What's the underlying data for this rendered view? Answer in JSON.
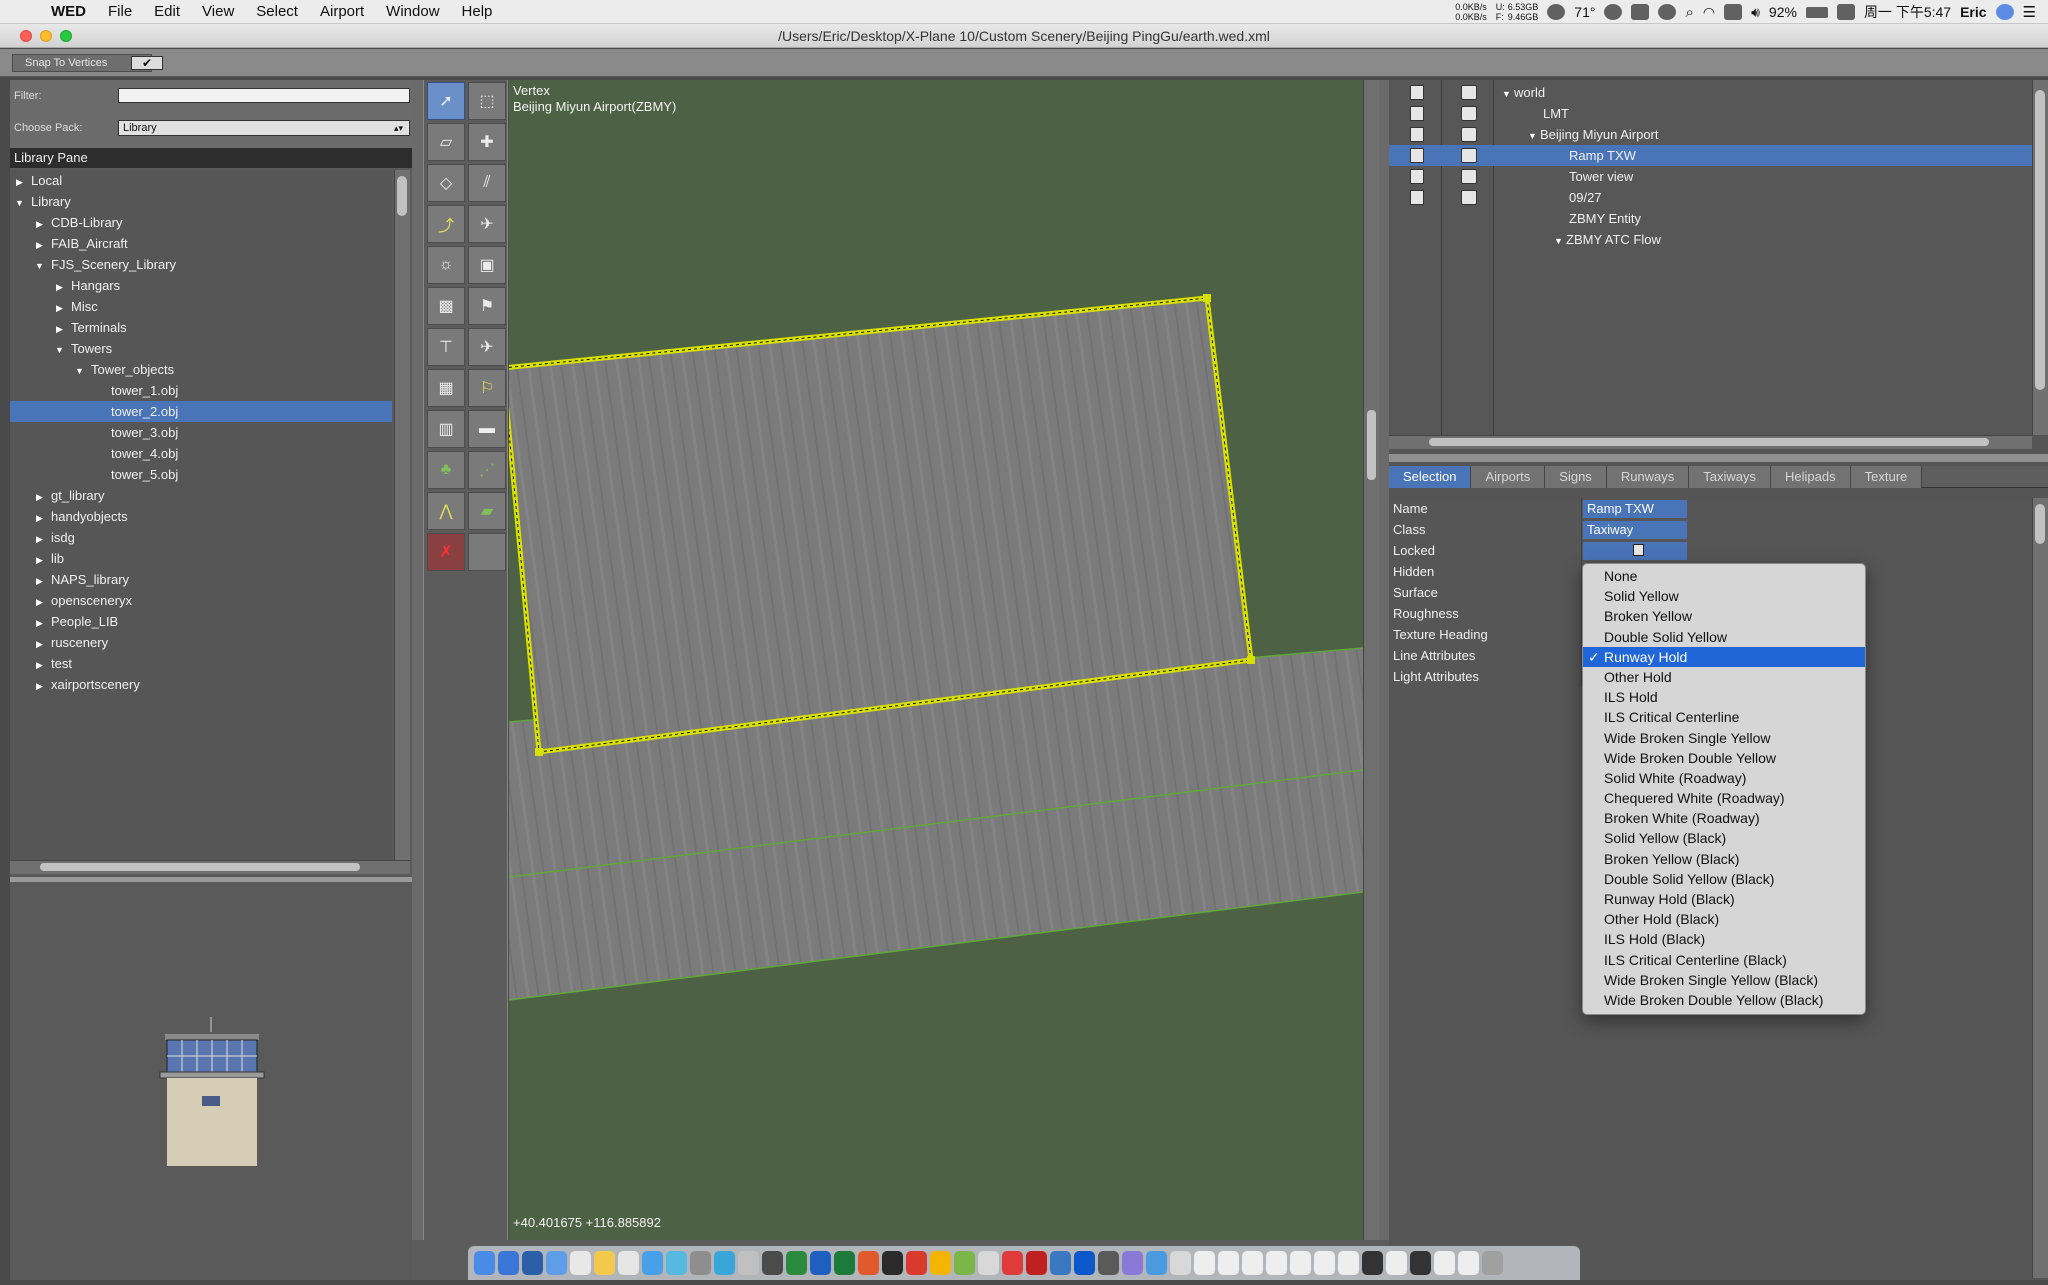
{
  "menubar": {
    "apple": "",
    "app": "WED",
    "items": [
      "File",
      "Edit",
      "View",
      "Select",
      "Airport",
      "Window",
      "Help"
    ],
    "net_up": "0.0KB/s",
    "net_down": "0.0KB/s",
    "mem_u_label": "U:",
    "mem_f_label": "F:",
    "mem_u": "6.53GB",
    "mem_f": "9.46GB",
    "temp": "71°",
    "battery": "92%",
    "datetime": "周一 下午5:47",
    "user": "Eric"
  },
  "window": {
    "title": "/Users/Eric/Desktop/X-Plane 10/Custom Scenery/Beijing PingGu/earth.wed.xml"
  },
  "toolbar": {
    "snap_label": "Snap To Vertices",
    "snap_check": "✔"
  },
  "library": {
    "filter_label": "Filter:",
    "filter_value": "",
    "choose_label": "Choose Pack:",
    "choose_value": "Library",
    "pane_title": "Library Pane",
    "tree": [
      {
        "label": "Local",
        "depth": 0,
        "arrow": "right",
        "selected": false
      },
      {
        "label": "Library",
        "depth": 0,
        "arrow": "down",
        "selected": false
      },
      {
        "label": "CDB-Library",
        "depth": 1,
        "arrow": "right",
        "selected": false
      },
      {
        "label": "FAIB_Aircraft",
        "depth": 1,
        "arrow": "right",
        "selected": false
      },
      {
        "label": "FJS_Scenery_Library",
        "depth": 1,
        "arrow": "down",
        "selected": false
      },
      {
        "label": "Hangars",
        "depth": 2,
        "arrow": "right",
        "selected": false
      },
      {
        "label": "Misc",
        "depth": 2,
        "arrow": "right",
        "selected": false
      },
      {
        "label": "Terminals",
        "depth": 2,
        "arrow": "right",
        "selected": false
      },
      {
        "label": "Towers",
        "depth": 2,
        "arrow": "down",
        "selected": false
      },
      {
        "label": "Tower_objects",
        "depth": 3,
        "arrow": "down",
        "selected": false
      },
      {
        "label": "tower_1.obj",
        "depth": 4,
        "arrow": "none",
        "selected": false
      },
      {
        "label": "tower_2.obj",
        "depth": 4,
        "arrow": "none",
        "selected": true
      },
      {
        "label": "tower_3.obj",
        "depth": 4,
        "arrow": "none",
        "selected": false
      },
      {
        "label": "tower_4.obj",
        "depth": 4,
        "arrow": "none",
        "selected": false
      },
      {
        "label": "tower_5.obj",
        "depth": 4,
        "arrow": "none",
        "selected": false
      },
      {
        "label": "gt_library",
        "depth": 1,
        "arrow": "right",
        "selected": false
      },
      {
        "label": "handyobjects",
        "depth": 1,
        "arrow": "right",
        "selected": false
      },
      {
        "label": "isdg",
        "depth": 1,
        "arrow": "right",
        "selected": false
      },
      {
        "label": "lib",
        "depth": 1,
        "arrow": "right",
        "selected": false
      },
      {
        "label": "NAPS_library",
        "depth": 1,
        "arrow": "right",
        "selected": false
      },
      {
        "label": "opensceneryx",
        "depth": 1,
        "arrow": "right",
        "selected": false
      },
      {
        "label": "People_LIB",
        "depth": 1,
        "arrow": "right",
        "selected": false
      },
      {
        "label": "ruscenery",
        "depth": 1,
        "arrow": "right",
        "selected": false
      },
      {
        "label": "test",
        "depth": 1,
        "arrow": "right",
        "selected": false
      },
      {
        "label": "xairportscenery",
        "depth": 1,
        "arrow": "right",
        "selected": false
      }
    ]
  },
  "tools": [
    {
      "icon": "vertex-tool-icon",
      "glyph": "➚",
      "active": true
    },
    {
      "icon": "marquee-tool-icon",
      "glyph": "⬚",
      "active": false
    },
    {
      "icon": "runway-tool-icon",
      "glyph": "▱",
      "active": false
    },
    {
      "icon": "helipad-tool-icon",
      "glyph": "✚",
      "active": false
    },
    {
      "icon": "taxiway-tool-icon",
      "glyph": "◇",
      "active": false
    },
    {
      "icon": "sealane-tool-icon",
      "glyph": "⫽",
      "active": false
    },
    {
      "icon": "taxiroute-tool-icon",
      "glyph": "⤴",
      "active": false
    },
    {
      "icon": "ramp-start-tool-icon",
      "glyph": "✈",
      "active": false
    },
    {
      "icon": "light-fixture-tool-icon",
      "glyph": "☼",
      "active": false
    },
    {
      "icon": "sign-tool-icon",
      "glyph": "▣",
      "active": false
    },
    {
      "icon": "object-tool-icon",
      "glyph": "▩",
      "active": false
    },
    {
      "icon": "windsock-tool-icon",
      "glyph": "⚑",
      "active": false
    },
    {
      "icon": "tower-viewpoint-tool-icon",
      "glyph": "⊤",
      "active": false
    },
    {
      "icon": "airplane-tool-icon",
      "glyph": "✈",
      "active": false
    },
    {
      "icon": "facade-tool-icon",
      "glyph": "▦",
      "active": false
    },
    {
      "icon": "atc-tool-icon",
      "glyph": "⚐",
      "active": false
    },
    {
      "icon": "building-tool-icon",
      "glyph": "▥",
      "active": false
    },
    {
      "icon": "truck-tool-icon",
      "glyph": "▬",
      "active": false
    },
    {
      "icon": "forest-tool-icon",
      "glyph": "♣",
      "active": false
    },
    {
      "icon": "string-tool-icon",
      "glyph": "⋰",
      "active": false
    },
    {
      "icon": "line-tool-icon",
      "glyph": "⋀",
      "active": false
    },
    {
      "icon": "polygon-tool-icon",
      "glyph": "▰",
      "active": false
    },
    {
      "icon": "exclusion-tool-icon",
      "glyph": "✗",
      "active": false
    },
    {
      "icon": "empty-tool-icon",
      "glyph": "",
      "active": false
    }
  ],
  "map": {
    "mode": "Vertex",
    "airport": "Beijing Miyun Airport(ZBMY)",
    "coords": "+40.401675 +116.885892",
    "colors": {
      "grass": "#4d6144",
      "pavement": "#7c7c7c",
      "selection": "#d8e000",
      "taxi_edge": "#5ea83a"
    }
  },
  "hierarchy": [
    {
      "label": "world",
      "indent": 0,
      "arrow": "down",
      "selected": false,
      "icons": true
    },
    {
      "label": "LMT",
      "indent": 1,
      "arrow": "none",
      "selected": false,
      "icons": true
    },
    {
      "label": "Beijing Miyun Airport",
      "indent": 1,
      "arrow": "down",
      "selected": false,
      "icons": true
    },
    {
      "label": "Ramp TXW",
      "indent": 2,
      "arrow": "none",
      "selected": true,
      "icons": true
    },
    {
      "label": "Tower view",
      "indent": 2,
      "arrow": "none",
      "selected": false,
      "icons": true
    },
    {
      "label": "09/27",
      "indent": 2,
      "arrow": "none",
      "selected": false,
      "icons": true
    },
    {
      "label": "ZBMY Entity",
      "indent": 2,
      "arrow": "none",
      "selected": false,
      "icons": false
    },
    {
      "label": "ZBMY ATC Flow",
      "indent": 2,
      "arrow": "down",
      "selected": false,
      "icons": false
    }
  ],
  "tabs": [
    "Selection",
    "Airports",
    "Signs",
    "Runways",
    "Taxiways",
    "Helipads",
    "Texture"
  ],
  "active_tab": "Selection",
  "properties": [
    {
      "name": "Name",
      "value": "Ramp TXW"
    },
    {
      "name": "Class",
      "value": "Taxiway"
    },
    {
      "name": "Locked",
      "value": ""
    },
    {
      "name": "Hidden",
      "value": ""
    },
    {
      "name": "Surface",
      "value": ""
    },
    {
      "name": "Roughness",
      "value": ""
    },
    {
      "name": "Texture Heading",
      "value": ""
    },
    {
      "name": "Line Attributes",
      "value": ""
    },
    {
      "name": "Light Attributes",
      "value": ""
    }
  ],
  "line_dropdown": {
    "selected": "Runway Hold",
    "options": [
      "None",
      "Solid Yellow",
      "Broken Yellow",
      "Double Solid Yellow",
      "Runway Hold",
      "Other Hold",
      "ILS Hold",
      "ILS Critical Centerline",
      "Wide Broken Single Yellow",
      "Wide Broken Double Yellow",
      "Solid White (Roadway)",
      "Chequered White (Roadway)",
      "Broken White (Roadway)",
      "Solid Yellow (Black)",
      "Broken Yellow (Black)",
      "Double Solid Yellow (Black)",
      "Runway Hold (Black)",
      "Other Hold (Black)",
      "ILS Hold (Black)",
      "ILS Critical Centerline (Black)",
      "Wide Broken Single Yellow (Black)",
      "Wide Broken Double Yellow (Black)"
    ]
  },
  "dock_colors": [
    "#4a8be8",
    "#3a76d8",
    "#2b5fa8",
    "#5d9ee6",
    "#e8e8e8",
    "#f2c94c",
    "#e6e6e6",
    "#47a0e8",
    "#58b9e0",
    "#8e8e8e",
    "#3aa5d9",
    "#c0c0c0",
    "#4b4b4b",
    "#2b8a3e",
    "#1f5fbf",
    "#1e7a3a",
    "#e05a2b",
    "#2a2a2a",
    "#d93a2b",
    "#f5b400",
    "#7ab648",
    "#d8d8d8",
    "#e03a3a",
    "#c02020",
    "#3a78c2",
    "#0a58ca",
    "#5a5a5a",
    "#8a7ad8",
    "#4a9ae0",
    "#d8d8d8",
    "#eeeeee",
    "#eeeeee",
    "#eeeeee",
    "#eeeeee",
    "#eeeeee",
    "#eeeeee",
    "#eeeeee",
    "#333333",
    "#eeeeee",
    "#333333",
    "#eeeeee",
    "#eeeeee",
    "#a0a0a0"
  ]
}
